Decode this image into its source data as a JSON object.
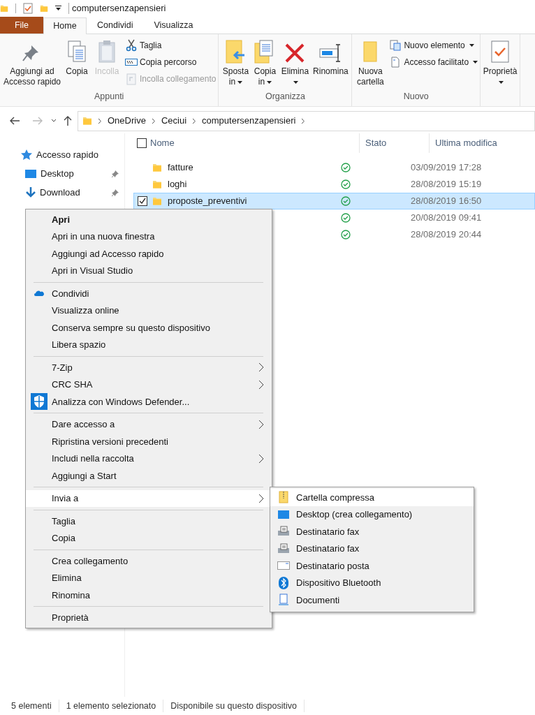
{
  "window": {
    "title": "computersenzapensieri"
  },
  "ribbon_tabs": [
    {
      "label": "File",
      "kind": "file",
      "selected": false
    },
    {
      "label": "Home",
      "kind": "tab",
      "selected": true
    },
    {
      "label": "Condividi",
      "kind": "tab",
      "selected": false
    },
    {
      "label": "Visualizza",
      "kind": "tab",
      "selected": false
    }
  ],
  "ribbon_groups": [
    {
      "label": "Appunti",
      "commands": [
        {
          "label": "Aggiungi ad Accesso rapido",
          "kind": "large",
          "dropdown": false,
          "disabled": false
        },
        {
          "label": "Copia",
          "kind": "large",
          "dropdown": false,
          "disabled": false
        },
        {
          "label": "Incolla",
          "kind": "large",
          "dropdown": false,
          "disabled": true
        },
        {
          "label": "Taglia",
          "kind": "small",
          "dropdown": false,
          "disabled": false
        },
        {
          "label": "Copia percorso",
          "kind": "small",
          "dropdown": false,
          "disabled": false
        },
        {
          "label": "Incolla collegamento",
          "kind": "small",
          "dropdown": false,
          "disabled": true
        }
      ]
    },
    {
      "label": "Organizza",
      "commands": [
        {
          "label": "Sposta in",
          "kind": "large",
          "dropdown": true,
          "disabled": false
        },
        {
          "label": "Copia in",
          "kind": "large",
          "dropdown": true,
          "disabled": false
        },
        {
          "label": "Elimina",
          "kind": "large",
          "dropdown": true,
          "disabled": false
        },
        {
          "label": "Rinomina",
          "kind": "large",
          "dropdown": false,
          "disabled": false
        }
      ]
    },
    {
      "label": "Nuovo",
      "commands": [
        {
          "label": "Nuova cartella",
          "kind": "large",
          "dropdown": false,
          "disabled": false
        },
        {
          "label": "Nuovo elemento",
          "kind": "small",
          "dropdown": true,
          "disabled": false
        },
        {
          "label": "Accesso facilitato",
          "kind": "small",
          "dropdown": true,
          "disabled": false
        }
      ]
    },
    {
      "commands": [
        {
          "label": "Proprietà",
          "kind": "large",
          "dropdown": true,
          "disabled": false
        }
      ]
    }
  ],
  "address_bar": {
    "path": [
      "OneDrive",
      "Ceciui",
      "computersenzapensieri"
    ]
  },
  "navigation_pane": {
    "items": [
      {
        "label": "Accesso rapido",
        "pinned": false
      },
      {
        "label": "Desktop",
        "pinned": true
      },
      {
        "label": "Download",
        "pinned": true
      }
    ]
  },
  "file_list": {
    "columns": [
      "Nome",
      "Stato",
      "Ultima modifica"
    ],
    "all_checked": false,
    "rows": [
      {
        "name": "fatture",
        "modified": "03/09/2019 17:28",
        "selected": false
      },
      {
        "name": "loghi",
        "modified": "28/08/2019 15:19",
        "selected": false
      },
      {
        "name": "proposte_preventivi",
        "modified": "28/08/2019 16:50",
        "selected": true
      },
      {
        "modified": "20/08/2019 09:41",
        "selected": false
      },
      {
        "modified": "28/08/2019 20:44",
        "selected": false
      }
    ]
  },
  "context_menu": {
    "sections": [
      [
        {
          "label": "Apri",
          "default": true,
          "submenu": false,
          "selected": false
        },
        {
          "label": "Apri in una nuova finestra",
          "default": false,
          "submenu": false,
          "selected": false
        },
        {
          "label": "Aggiungi ad Accesso rapido",
          "default": false,
          "submenu": false,
          "selected": false
        },
        {
          "label": "Apri in Visual Studio",
          "default": false,
          "submenu": false,
          "selected": false
        }
      ],
      [
        {
          "label": "Condividi",
          "default": false,
          "submenu": false,
          "selected": false
        },
        {
          "label": "Visualizza online",
          "default": false,
          "submenu": false,
          "selected": false
        },
        {
          "label": "Conserva sempre su questo dispositivo",
          "default": false,
          "submenu": false,
          "selected": false
        },
        {
          "label": "Libera spazio",
          "default": false,
          "submenu": false,
          "selected": false
        }
      ],
      [
        {
          "label": "7-Zip",
          "default": false,
          "submenu": true,
          "selected": false
        },
        {
          "label": "CRC SHA",
          "default": false,
          "submenu": true,
          "selected": false
        },
        {
          "label": "Analizza con Windows Defender...",
          "default": false,
          "submenu": false,
          "selected": false
        }
      ],
      [
        {
          "label": "Dare accesso a",
          "default": false,
          "submenu": true,
          "selected": false
        },
        {
          "label": "Ripristina versioni precedenti",
          "default": false,
          "submenu": false,
          "selected": false
        },
        {
          "label": "Includi nella raccolta",
          "default": false,
          "submenu": true,
          "selected": false
        },
        {
          "label": "Aggiungi a Start",
          "default": false,
          "submenu": false,
          "selected": false
        }
      ],
      [
        {
          "label": "Invia a",
          "default": false,
          "submenu": true,
          "selected": true
        }
      ],
      [
        {
          "label": "Taglia",
          "default": false,
          "submenu": false,
          "selected": false
        },
        {
          "label": "Copia",
          "default": false,
          "submenu": false,
          "selected": false
        }
      ],
      [
        {
          "label": "Crea collegamento",
          "default": false,
          "submenu": false,
          "selected": false
        },
        {
          "label": "Elimina",
          "default": false,
          "submenu": false,
          "selected": false
        },
        {
          "label": "Rinomina",
          "default": false,
          "submenu": false,
          "selected": false
        }
      ],
      [
        {
          "label": "Proprietà",
          "default": false,
          "submenu": false,
          "selected": false
        }
      ]
    ]
  },
  "send_to_menu": {
    "items": [
      {
        "label": "Cartella compressa",
        "selected": true
      },
      {
        "label": "Desktop (crea collegamento)",
        "selected": false
      },
      {
        "label": "Destinatario fax",
        "selected": false
      },
      {
        "label": "Destinatario fax",
        "selected": false
      },
      {
        "label": "Destinatario posta",
        "selected": false
      },
      {
        "label": "Dispositivo Bluetooth",
        "selected": false
      },
      {
        "label": "Documenti",
        "selected": false
      }
    ]
  },
  "status_bar": [
    "5 elementi",
    "1 elemento selezionato",
    "Disponibile su questo dispositivo"
  ]
}
